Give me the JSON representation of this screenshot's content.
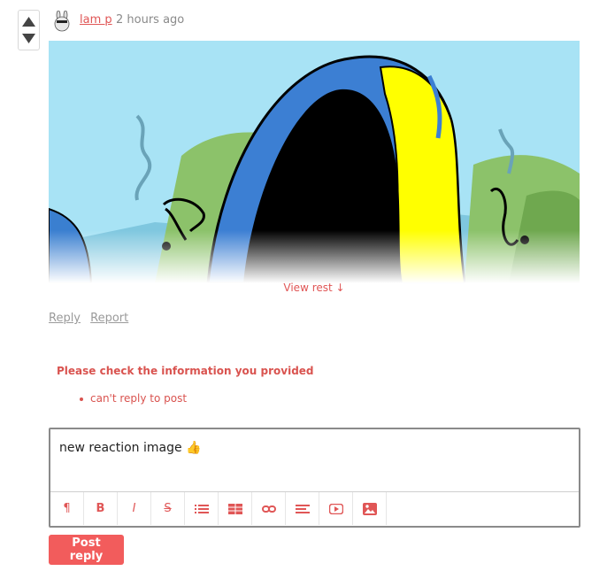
{
  "comment": {
    "author": "lam p",
    "time": "2 hours ago",
    "view_rest": "View rest ↓",
    "actions": {
      "reply": "Reply",
      "report": "Report"
    }
  },
  "errors": {
    "title": "Please check the information you provided",
    "items": [
      "can't reply to post"
    ]
  },
  "editor": {
    "value": "new reaction image 👍"
  },
  "toolbar": {
    "buttons": [
      "paragraph-icon",
      "bold-icon",
      "italic-icon",
      "strikethrough-icon",
      "bulleted-list-icon",
      "table-icon",
      "link-icon",
      "align-icon",
      "video-icon",
      "image-icon"
    ]
  },
  "post_button": "Post reply",
  "colors": {
    "accent": "#e05656",
    "error": "#d9534f",
    "button": "#f25c5c"
  }
}
